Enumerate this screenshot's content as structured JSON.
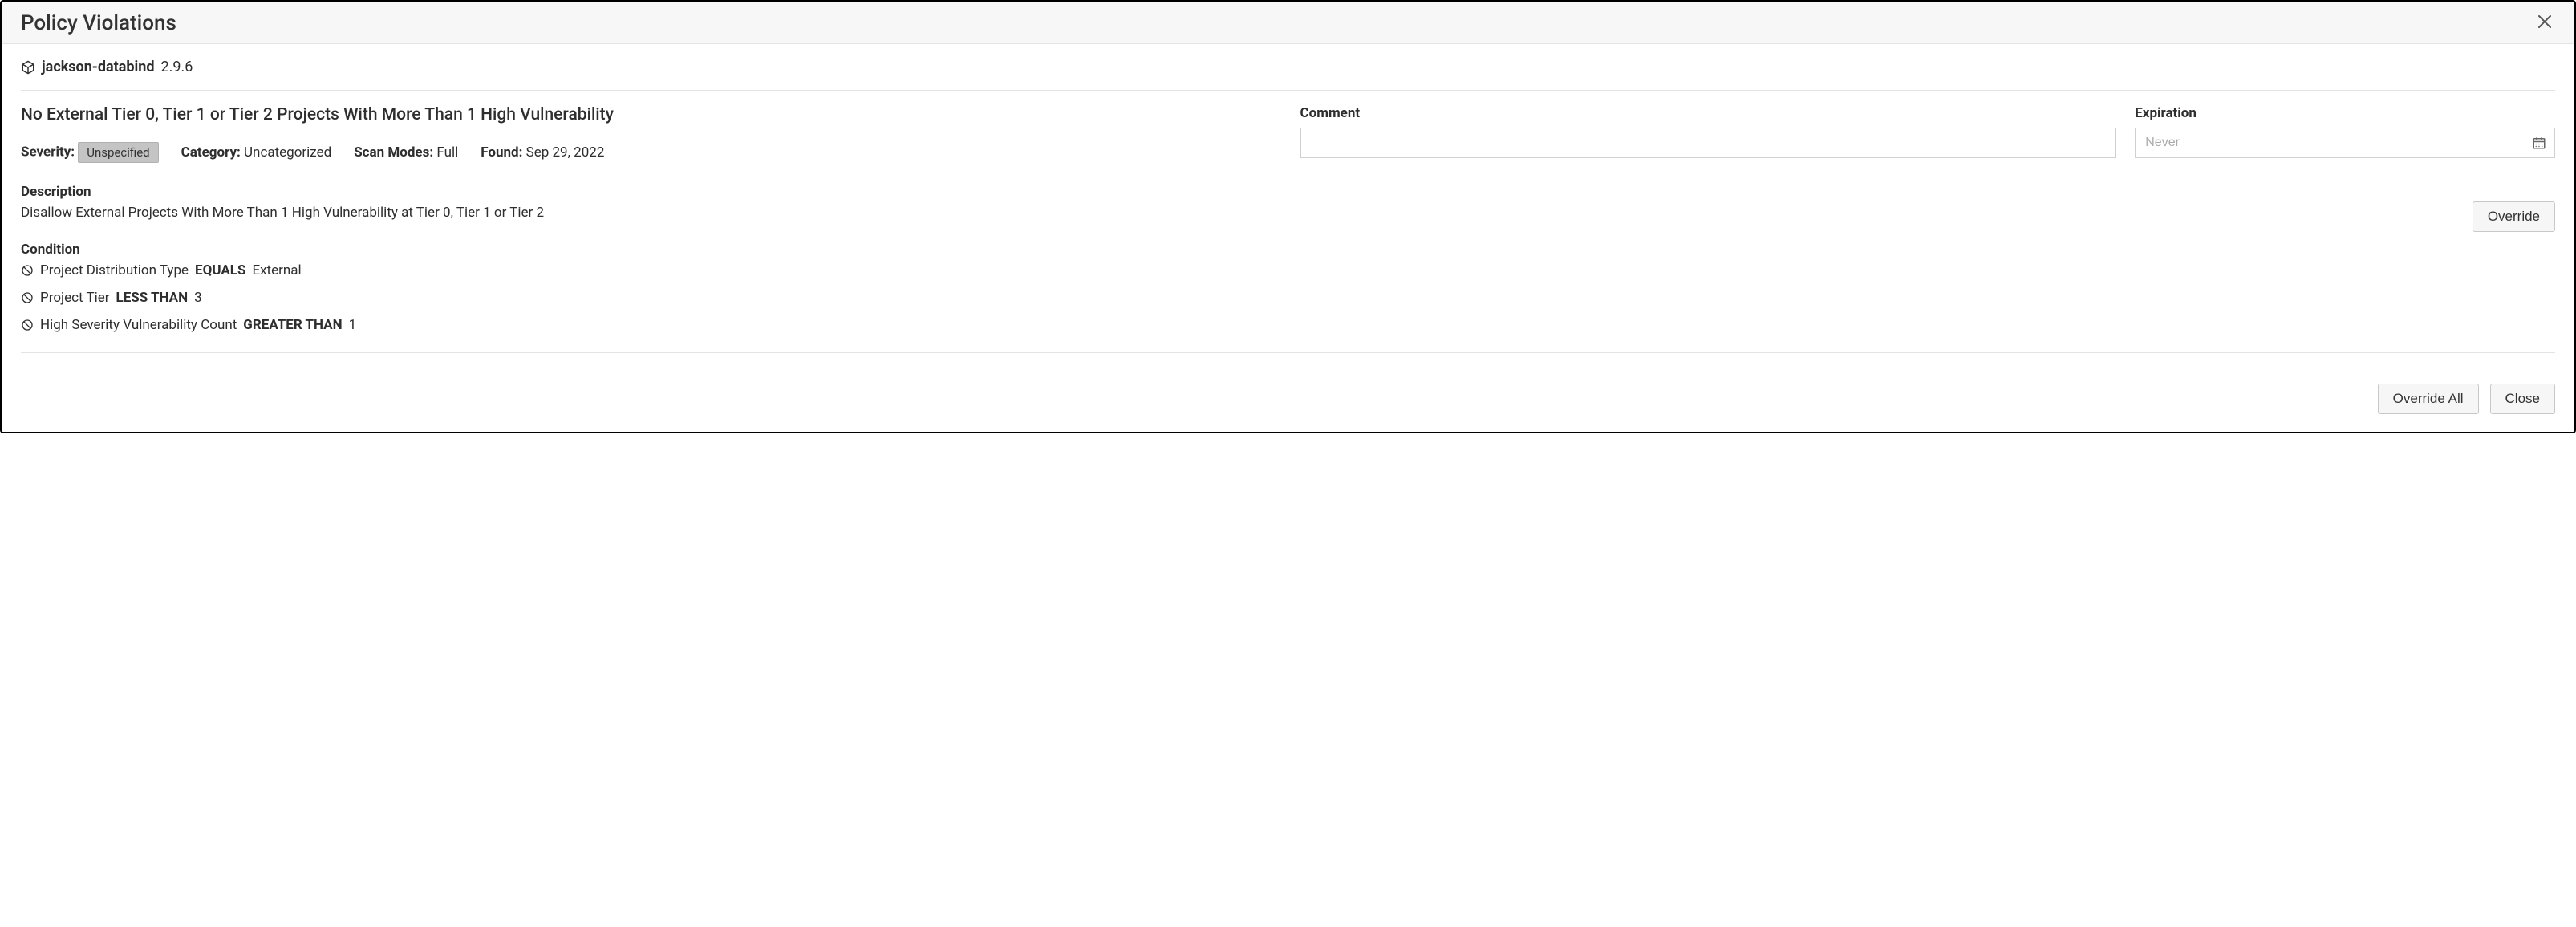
{
  "header": {
    "title": "Policy Violations"
  },
  "component": {
    "name": "jackson-databind",
    "version": "2.9.6"
  },
  "policy": {
    "title": "No External Tier 0, Tier 1 or Tier 2 Projects With More Than 1 High Vulnerability",
    "severity_label": "Severity:",
    "severity_value": "Unspecified",
    "category_label": "Category:",
    "category_value": "Uncategorized",
    "scan_modes_label": "Scan Modes:",
    "scan_modes_value": "Full",
    "found_label": "Found:",
    "found_value": "Sep 29, 2022",
    "description_label": "Description",
    "description_text": "Disallow External Projects With More Than 1 High Vulnerability at Tier 0, Tier 1 or Tier 2",
    "condition_label": "Condition",
    "conditions": [
      {
        "subject": "Project Distribution Type",
        "op": "EQUALS",
        "value": "External"
      },
      {
        "subject": "Project Tier",
        "op": "LESS THAN",
        "value": "3"
      },
      {
        "subject": "High Severity Vulnerability Count",
        "op": "GREATER THAN",
        "value": "1"
      }
    ]
  },
  "form": {
    "comment_label": "Comment",
    "comment_value": "",
    "expiration_label": "Expiration",
    "expiration_placeholder": "Never",
    "expiration_value": ""
  },
  "buttons": {
    "override": "Override",
    "override_all": "Override All",
    "close": "Close"
  }
}
